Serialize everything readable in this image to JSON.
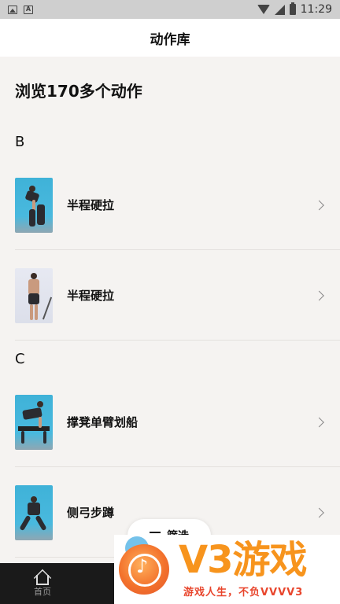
{
  "status_bar": {
    "time": "11:29"
  },
  "title": "动作库",
  "heading": "浏览170多个动作",
  "sections": [
    {
      "letter": "B",
      "items": [
        {
          "label": "半程硬拉"
        },
        {
          "label": "半程硬拉"
        }
      ]
    },
    {
      "letter": "C",
      "items": [
        {
          "label": "撑凳单臂划船"
        },
        {
          "label": "侧弓步蹲"
        }
      ]
    }
  ],
  "filter": {
    "label": "筛选"
  },
  "bottom_nav": {
    "home_label": "首页"
  },
  "watermark": {
    "big": "V3游戏",
    "small": "游戏人生，不负VVVV3"
  },
  "colors": {
    "accent": "#f7941d",
    "nav_bg": "#1a1a1a",
    "page_bg": "#f5f3f1"
  }
}
